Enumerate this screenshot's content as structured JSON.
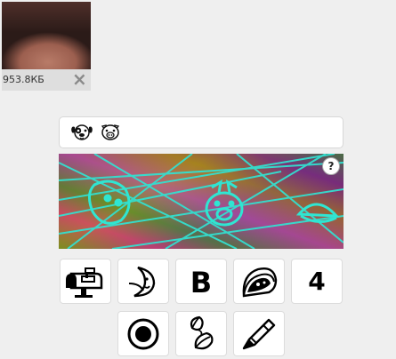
{
  "upload": {
    "size": "953.8КБ"
  },
  "captcha": {
    "selected_icons": [
      "dog-face-icon",
      "pig-face-icon"
    ],
    "help": "?"
  },
  "options": {
    "row1": [
      "mailbox-icon",
      "crescent-moon-face-icon",
      "bold-b-icon",
      "taco-icon",
      "4"
    ],
    "row2": [
      "radio-button-icon",
      "leaves-icon",
      "crayon-icon"
    ]
  }
}
